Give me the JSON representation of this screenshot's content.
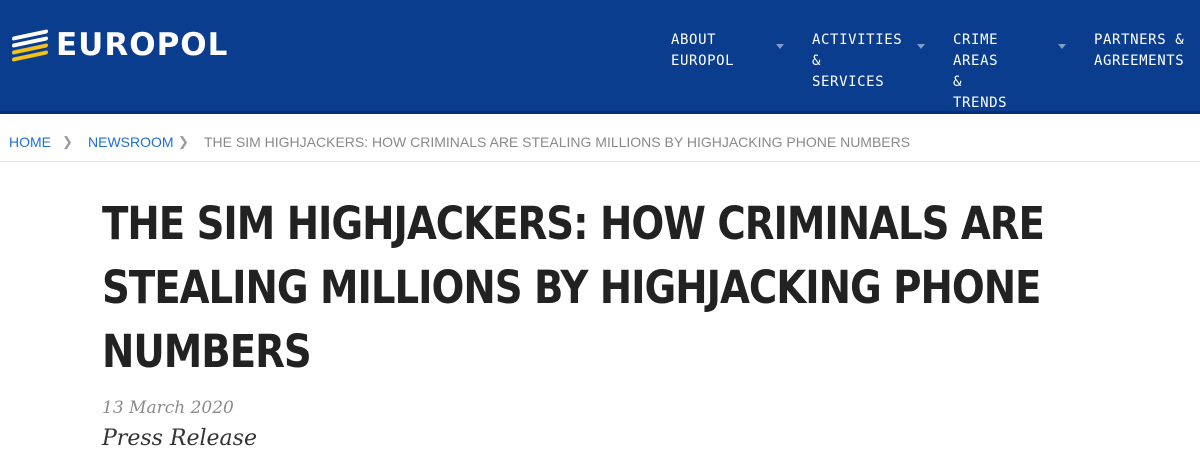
{
  "brand": {
    "logo_text": "EUROPOL",
    "colors": {
      "header_bg": "#0b3d8f",
      "accent": "#f2c21b",
      "link": "#1f6fcf"
    }
  },
  "nav": {
    "items": [
      {
        "line1": "ABOUT",
        "line2": "EUROPOL"
      },
      {
        "line1": "ACTIVITIES &",
        "line2": "SERVICES"
      },
      {
        "line1": "CRIME AREAS &",
        "line2": "TRENDS"
      },
      {
        "line1": "PARTNERS &",
        "line2": "AGREEMENTS"
      }
    ]
  },
  "breadcrumb": {
    "home": "HOME",
    "newsroom": "NEWSROOM",
    "current": "THE SIM HIGHJACKERS: HOW CRIMINALS ARE STEALING MILLIONS BY HIGHJACKING PHONE NUMBERS",
    "separator": "❯"
  },
  "article": {
    "title_lines": [
      "THE SIM HIGHJACKERS: HOW CRIMINALS ARE",
      "STEALING MILLIONS BY HIGHJACKING PHONE",
      "NUMBERS"
    ],
    "date": "13 March 2020",
    "type": "Press Release"
  }
}
